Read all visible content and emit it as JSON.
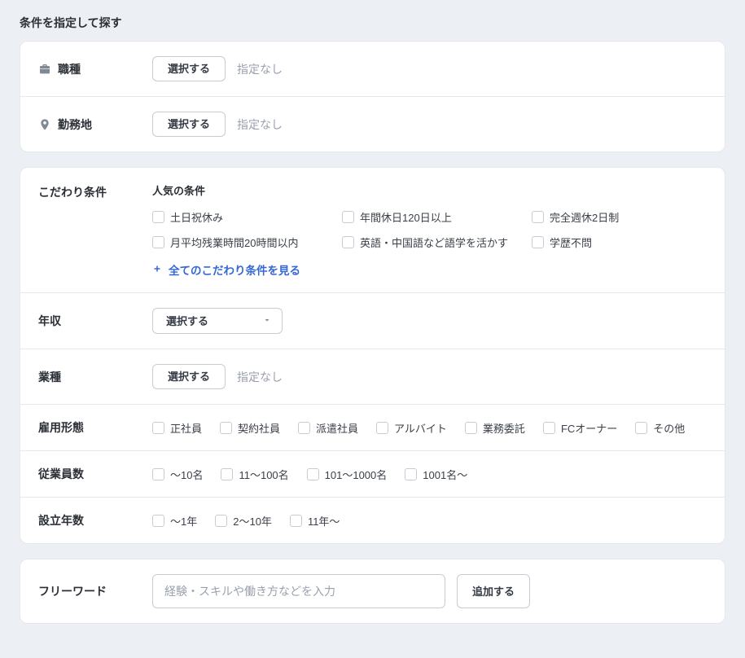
{
  "header": {
    "title": "条件を指定して探す"
  },
  "jobType": {
    "label": "職種",
    "selectButton": "選択する",
    "placeholder": "指定なし"
  },
  "workLocation": {
    "label": "勤務地",
    "selectButton": "選択する",
    "placeholder": "指定なし"
  },
  "kodawari": {
    "label": "こだわり条件",
    "popularTitle": "人気の条件",
    "options": [
      "土日祝休み",
      "年間休日120日以上",
      "完全週休2日制",
      "月平均残業時間20時間以内",
      "英語・中国語など語学を活かす",
      "学歴不問"
    ],
    "expandLabel": "全てのこだわり条件を見る"
  },
  "salary": {
    "label": "年収",
    "selectLabel": "選択する"
  },
  "industry": {
    "label": "業種",
    "selectButton": "選択する",
    "placeholder": "指定なし"
  },
  "employmentType": {
    "label": "雇用形態",
    "options": [
      "正社員",
      "契約社員",
      "派遣社員",
      "アルバイト",
      "業務委託",
      "FCオーナー",
      "その他"
    ]
  },
  "companySize": {
    "label": "従業員数",
    "options": [
      "～10名",
      "11～100名",
      "101～1000名",
      "1001名～"
    ]
  },
  "companyAge": {
    "label": "設立年数",
    "options": [
      "～1年",
      "2～10年",
      "11年～"
    ]
  },
  "freeWord": {
    "label": "フリーワード",
    "placeholder": "経験・スキルや働き方などを入力",
    "addButton": "追加する"
  }
}
